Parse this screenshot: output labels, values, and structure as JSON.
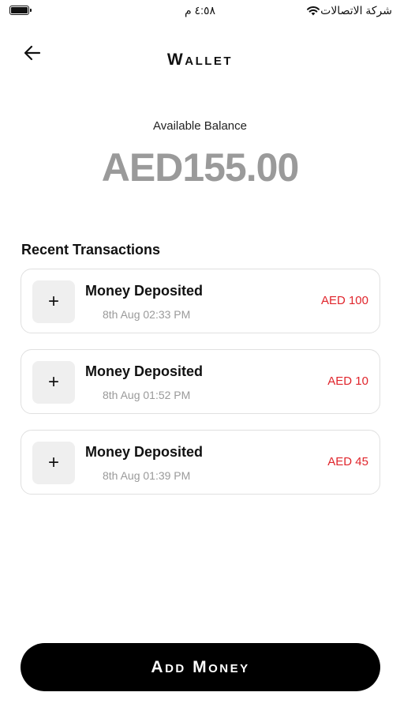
{
  "status_bar": {
    "time": "٤:٥٨ م",
    "carrier": "شركة الاتصالات",
    "battery_icon": "battery-icon",
    "wifi_icon": "wifi-icon"
  },
  "header": {
    "back_icon": "arrow-left-icon",
    "title": "Wallet"
  },
  "balance": {
    "label": "Available Balance",
    "amount": "AED155.00"
  },
  "transactions": {
    "title": "Recent Transactions",
    "icon": "plus-icon",
    "items": [
      {
        "title": "Money Deposited",
        "time": "8th Aug 02:33 PM",
        "amount": "AED 100"
      },
      {
        "title": "Money Deposited",
        "time": "8th Aug 01:52 PM",
        "amount": "AED 10"
      },
      {
        "title": "Money Deposited",
        "time": "8th Aug 01:39 PM",
        "amount": "AED 45"
      }
    ]
  },
  "footer": {
    "add_money_label": "Add Money"
  },
  "colors": {
    "accent": "#000000",
    "amount_red": "#e0242b",
    "balance_gray": "#9a9a9a"
  }
}
